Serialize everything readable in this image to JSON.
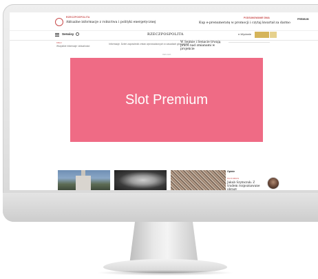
{
  "topbar": {
    "kicker_left": "RZECZPOSPOLITA",
    "headline_left": "Aktualne informacje z rolnictwa i polityki energetycznej",
    "kicker_right": "PODSUMOWANIE DNIA",
    "headline_right": "Kup e-prenumeratę w promocji i czytaj kwartał za darmo",
    "badge": "PREMIUM"
  },
  "nav": {
    "services": "Serwisy",
    "logo": "RZECZPOSPOLITA",
    "edition": "e-Wydanie"
  },
  "strip": {
    "kicker": "KRAJ",
    "text_left": "Wszystkie informacje i aktualności",
    "text_mid": "Informacje. Dzień zapowiedzi zmian wprowadzonych w zasadach głosowania",
    "text_right": "W Sejmie i Senacie trwają prace nad zmianami w projekcie"
  },
  "ad_label": "REKLAMA",
  "premium": {
    "label": "Slot Premium"
  },
  "opinion": {
    "heading": "Opinie",
    "kicker": "PLUS MINUS",
    "title": "Jakub Szymczuk: Z trudem rozpoznawane obrazy"
  },
  "colors": {
    "premium_bg": "#ef6b85",
    "accent": "#c84a4a",
    "subscribe": "#d5b45a"
  }
}
